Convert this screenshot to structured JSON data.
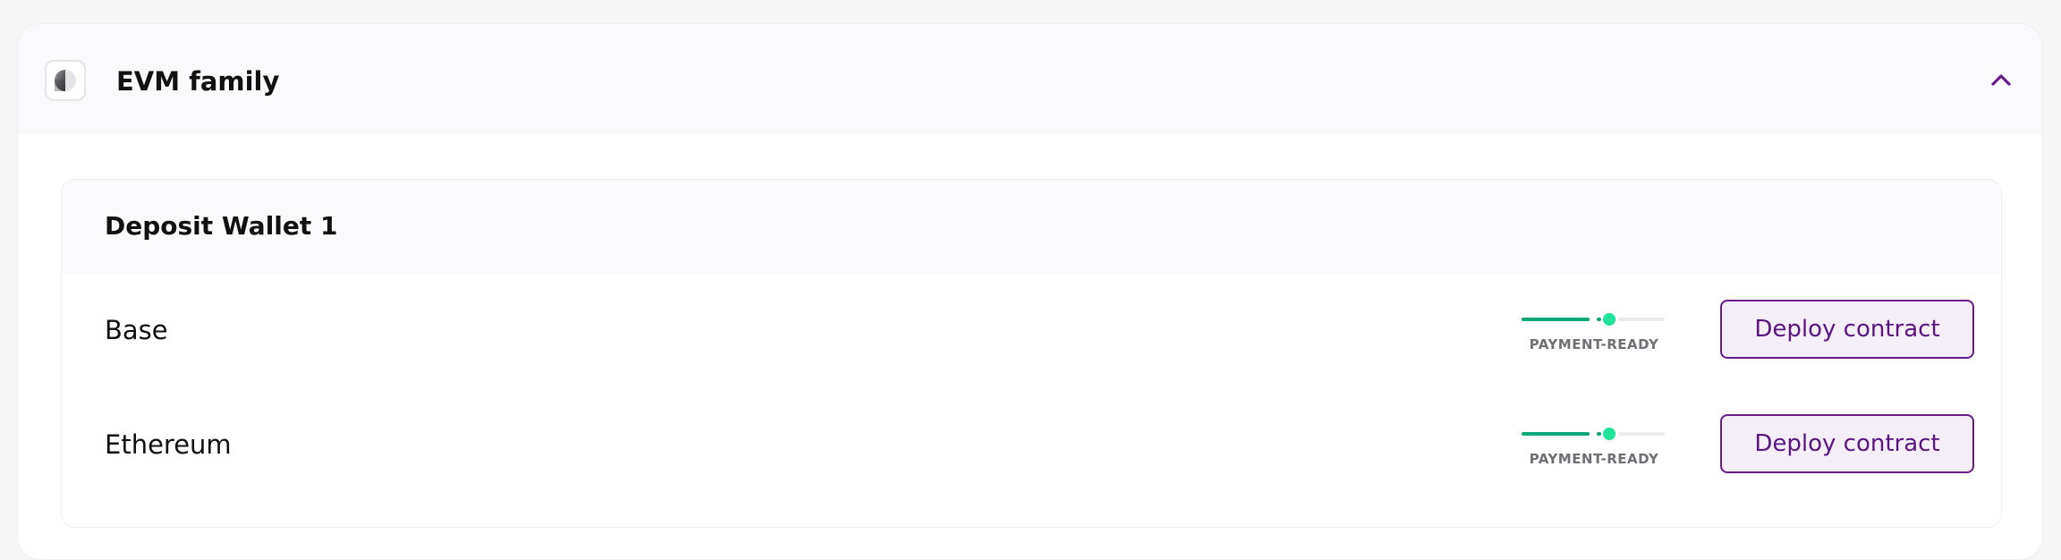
{
  "family": {
    "title": "EVM family",
    "icon": "half-circle-token-icon",
    "toggle_icon": "chevron-up-icon",
    "accent_color": "#6a1b8a"
  },
  "wallet": {
    "title": "Deposit Wallet 1",
    "chains": [
      {
        "name": "Base",
        "status": "PAYMENT-READY",
        "readiness_level": 0.6,
        "action_label": "Deploy contract"
      },
      {
        "name": "Ethereum",
        "status": "PAYMENT-READY",
        "readiness_level": 0.6,
        "action_label": "Deploy contract"
      }
    ]
  },
  "colors": {
    "status_green": "#0ea777",
    "status_knob": "#22e39a",
    "button_text": "#5b1580",
    "button_bg": "#f3eef8"
  }
}
